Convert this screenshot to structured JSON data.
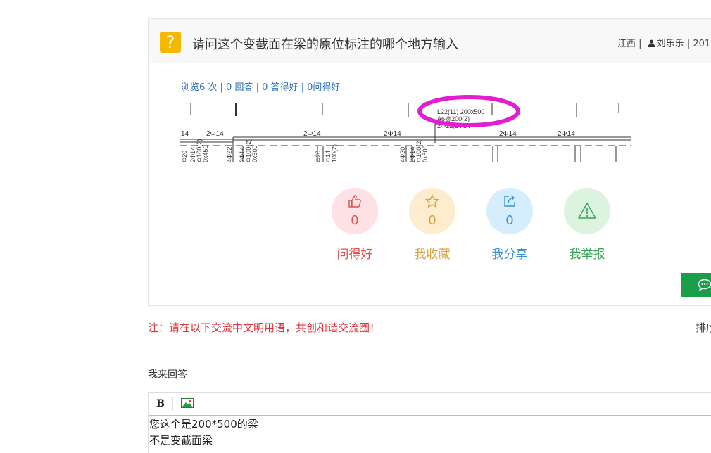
{
  "question": {
    "icon": "question-mark-icon",
    "title": "请问这个变截面在梁的原位标注的哪个地方输入",
    "region": "江西",
    "user_icon": "user-icon",
    "author": "刘乐乐",
    "date_partial": "201",
    "stats": "浏览6 次 | 0 回答 | 0 答得好 | 0问得好"
  },
  "drawing": {
    "beam_label_line1": "L22(11) 200x500",
    "beam_label_line2": "A6@200(2)",
    "beam_label_line3": "2Φ12;2Φ14",
    "top_rebar_labels": [
      "14",
      "2Φ14",
      "2Φ14",
      "2Φ14",
      "2Φ14",
      "2Φ14"
    ],
    "left_vertical_labels": [
      "Φ20",
      "2Φ14",
      "Φ100(2)",
      "0x450",
      "4Φ22",
      "2Φ14",
      "Φ100(2)",
      "0x500",
      "Φ20",
      "Φ14",
      "100(2)",
      "4Φ20",
      "2Φ14",
      "Φ100(2)",
      "0x500"
    ],
    "highlight_color": "#e020d0"
  },
  "actions": [
    {
      "label": "问得好",
      "count": "0",
      "icon": "thumbs-up-icon",
      "color": "#d9534f",
      "bg": "#fde1e4"
    },
    {
      "label": "我收藏",
      "count": "0",
      "icon": "star-icon",
      "color": "#d9a13a",
      "bg": "#fdeccd"
    },
    {
      "label": "我分享",
      "count": "0",
      "icon": "share-icon",
      "color": "#3a93d2",
      "bg": "#d6eefc"
    },
    {
      "label": "我举报",
      "count": "",
      "icon": "warning-icon",
      "color": "#3aa25a",
      "bg": "#dcf3df"
    }
  ],
  "chat_icon": "chat-bubble-icon",
  "notice": "注：请在以下交流中文明用语，共创和谐交流圈！",
  "sort_label": "排序",
  "answer_label": "我来回答",
  "editor": {
    "bold_label": "B",
    "image_icon": "image-icon",
    "line1": "您这个是200*500的梁",
    "line2": "不是变截面梁"
  },
  "colors": {
    "accent_green": "#1a9e4a",
    "link_blue": "#2f6fb5",
    "notice_red": "#d9363e",
    "question_yellow": "#f5b800"
  }
}
